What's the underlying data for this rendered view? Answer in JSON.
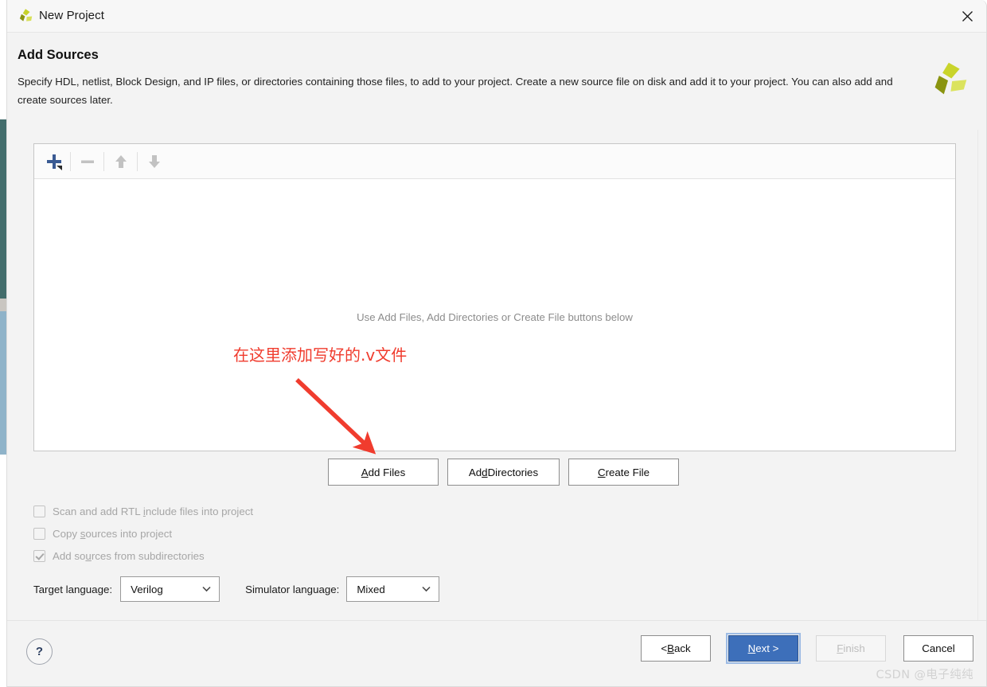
{
  "window": {
    "title": "New Project",
    "icon": "xilinx-logo-icon",
    "close_icon": "close-icon"
  },
  "header": {
    "title": "Add Sources",
    "description": "Specify HDL, netlist, Block Design, and IP files, or directories containing those files, to add to your project. Create a new source file on disk and add it to your project. You can also add and create sources later.",
    "logo": "xilinx-logo-icon"
  },
  "sources_panel": {
    "toolbar": [
      {
        "name": "add-icon",
        "glyph": "+",
        "color": "#3a5a93",
        "enabled": true,
        "has_dropdown": true
      },
      {
        "name": "remove-icon",
        "glyph": "−",
        "color": "#b8b8b8",
        "enabled": false,
        "has_dropdown": false
      },
      {
        "name": "move-up-icon",
        "glyph": "↑",
        "color": "#b8b8b8",
        "enabled": false,
        "has_dropdown": false
      },
      {
        "name": "move-down-icon",
        "glyph": "↓",
        "color": "#b8b8b8",
        "enabled": false,
        "has_dropdown": false
      }
    ],
    "empty_text": "Use Add Files, Add Directories or Create File buttons below"
  },
  "annotation": {
    "text": "在这里添加写好的.v文件",
    "color": "#f03c2e",
    "arrow": "red-arrow-icon"
  },
  "action_buttons": [
    {
      "name": "add-files-button",
      "prefix": "",
      "mnemonic": "A",
      "suffix": "dd Files"
    },
    {
      "name": "add-directories-button",
      "prefix": "Ad",
      "mnemonic": "d",
      "suffix": " Directories"
    },
    {
      "name": "create-file-button",
      "prefix": "",
      "mnemonic": "C",
      "suffix": "reate File"
    }
  ],
  "options": [
    {
      "name": "scan-rtl-include-checkbox",
      "prefix": "Scan and add RTL ",
      "mnemonic": "i",
      "suffix": "nclude files into project",
      "checked": false,
      "enabled": false
    },
    {
      "name": "copy-sources-checkbox",
      "prefix": "Copy ",
      "mnemonic": "s",
      "suffix": "ources into project",
      "checked": false,
      "enabled": false
    },
    {
      "name": "add-subdirectories-checkbox",
      "prefix": "Add so",
      "mnemonic": "u",
      "suffix": "rces from subdirectories",
      "checked": true,
      "enabled": false
    }
  ],
  "languages": {
    "target_label": "Target language:",
    "target_value": "Verilog",
    "simulator_label": "Simulator language:",
    "simulator_value": "Mixed"
  },
  "footer": {
    "help_glyph": "?",
    "buttons": [
      {
        "name": "back-button",
        "prefix": "< ",
        "mnemonic": "B",
        "suffix": "ack",
        "state": "normal"
      },
      {
        "name": "next-button",
        "prefix": "",
        "mnemonic": "N",
        "suffix": "ext >",
        "state": "primary"
      },
      {
        "name": "finish-button",
        "prefix": "",
        "mnemonic": "F",
        "suffix": "inish",
        "state": "disabled"
      },
      {
        "name": "cancel-button",
        "prefix": "Cancel",
        "mnemonic": "",
        "suffix": "",
        "state": "normal"
      }
    ]
  },
  "watermark": "CSDN @电子纯纯",
  "colors": {
    "accent": "#3d6fba",
    "logo_light": "#c7d22a",
    "logo_dark": "#8a9410",
    "annotation": "#f03c2e",
    "strip_teal": "#436d6c",
    "strip_blue": "#8fb3c9"
  }
}
